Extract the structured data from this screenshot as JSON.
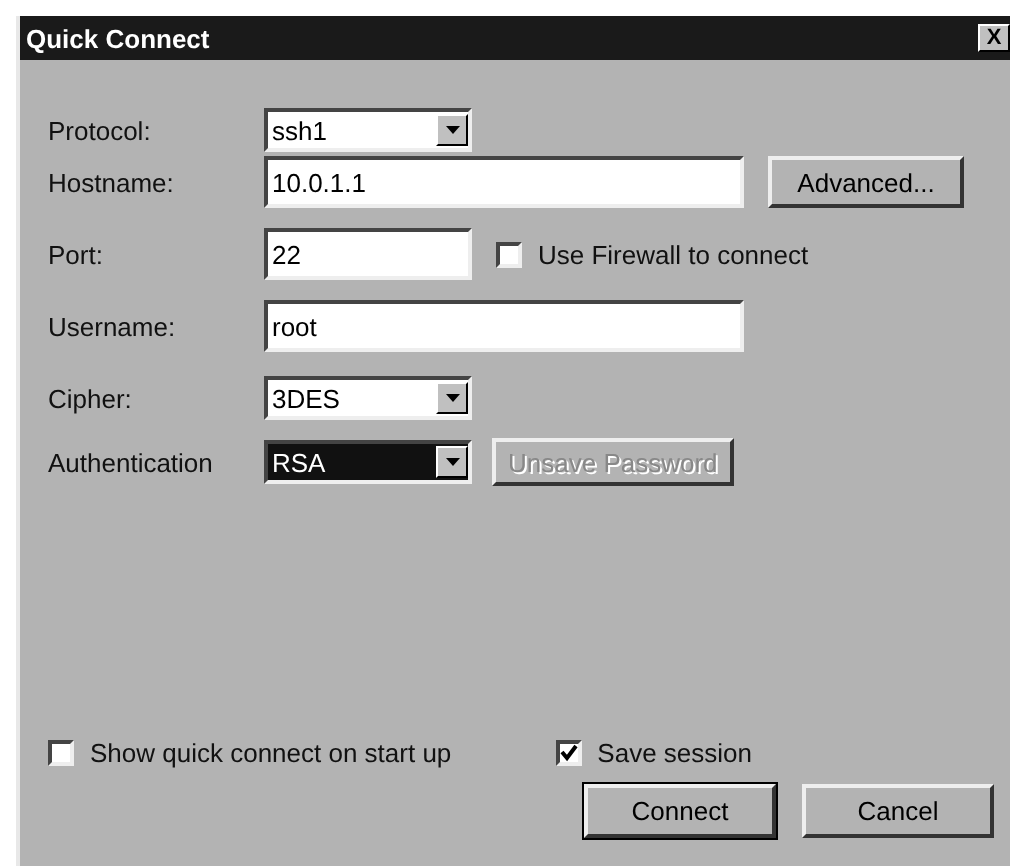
{
  "window": {
    "title": "Quick Connect",
    "close": "X"
  },
  "fields": [
    {
      "label": "Protocol:",
      "kind": "select",
      "value": "ssh1",
      "focused": false
    },
    {
      "label": "Hostname:",
      "kind": "text",
      "value": "10.0.1.1",
      "wide": true,
      "button": {
        "label": "Advanced...",
        "disabled": false
      }
    },
    {
      "label": "Port:",
      "kind": "text",
      "value": "22",
      "wide": false,
      "checkbox": {
        "label": "Use Firewall to connect",
        "checked": false
      }
    },
    {
      "label": "Username:",
      "kind": "text",
      "value": "root",
      "wide": true
    },
    {
      "label": "Cipher:",
      "kind": "select",
      "value": "3DES",
      "focused": false
    },
    {
      "label": "Authentication",
      "kind": "select",
      "value": "RSA",
      "focused": true,
      "button": {
        "label": "Unsave Password",
        "disabled": true
      }
    }
  ],
  "options": [
    {
      "label": "Show quick connect on start up",
      "checked": false
    },
    {
      "label": "Save session",
      "checked": true
    }
  ],
  "buttons": [
    {
      "label": "Connect",
      "default": true
    },
    {
      "label": "Cancel",
      "default": false
    }
  ]
}
